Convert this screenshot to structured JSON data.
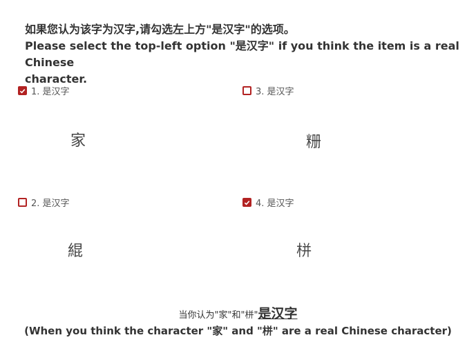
{
  "instructions": {
    "line1": "如果您认为该字为汉字,请勾选左上方\"是汉字\"的选项。",
    "line2": "Please select the top-left option \"是汉字\" if you think the item is a real Chinese",
    "line3": "character."
  },
  "options": [
    {
      "label": "1. 是汉字",
      "checked": true,
      "character": "家"
    },
    {
      "label": "3. 是汉字",
      "checked": false,
      "character": "粣"
    },
    {
      "label": "2. 是汉字",
      "checked": false,
      "character": "緄"
    },
    {
      "label": "4. 是汉字",
      "checked": true,
      "character": "栟"
    }
  ],
  "footer": {
    "prefix": "当你认为\"家\"和\"栟\"",
    "emphasis": "是汉字",
    "explanation": "(When you think the character \"家\" and \"栟\" are a real Chinese character)"
  },
  "colors": {
    "checkbox": "#b22222",
    "text": "#333333"
  }
}
